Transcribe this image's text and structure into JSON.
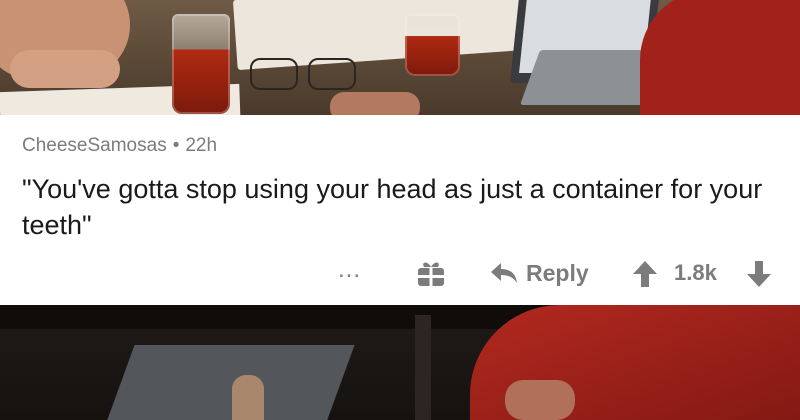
{
  "comment": {
    "username": "CheeseSamosas",
    "separator": "•",
    "age": "22h",
    "text": "\"You've gotta stop using your head as just a container for your teeth\""
  },
  "actions": {
    "more_label": "...",
    "reply_label": "Reply",
    "score": "1.8k"
  },
  "icons": {
    "more": "ellipsis-icon",
    "gift": "gift-icon",
    "reply": "reply-arrow-icon",
    "upvote": "upvote-arrow-icon",
    "downvote": "downvote-arrow-icon"
  },
  "colors": {
    "card_background": "#ffffff",
    "text_primary": "#1a1a1b",
    "text_muted": "#7c7c7c"
  }
}
